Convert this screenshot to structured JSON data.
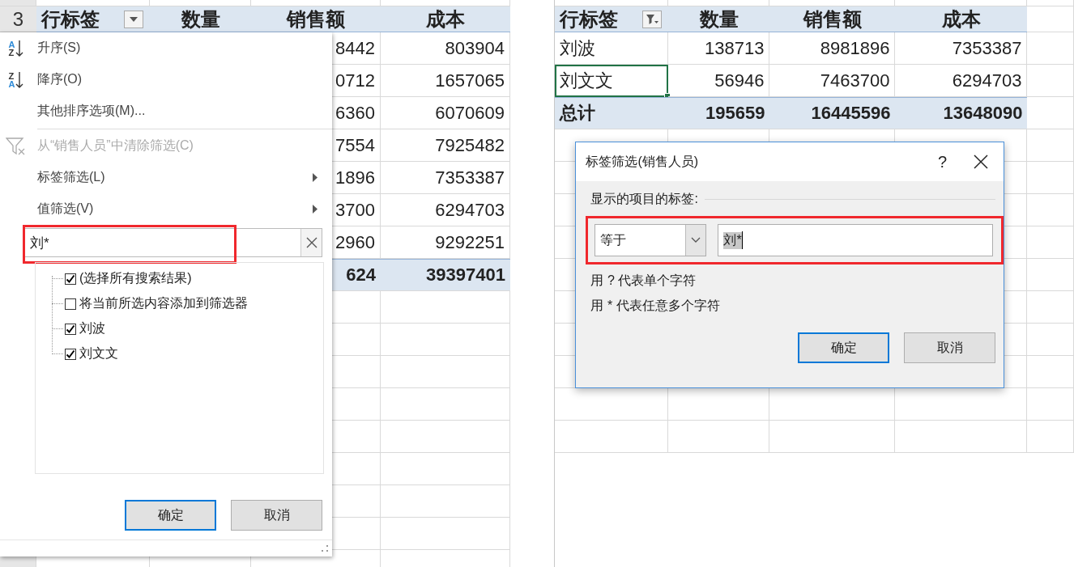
{
  "left": {
    "row_number": "3",
    "columns": [
      "行标签",
      "数量",
      "销售额",
      "成本"
    ],
    "header_filtered": false,
    "rows": [
      [
        "8442",
        "803904"
      ],
      [
        "0712",
        "1657065"
      ],
      [
        "6360",
        "6070609"
      ],
      [
        "7554",
        "7925482"
      ],
      [
        "1896",
        "7353387"
      ],
      [
        "3700",
        "6294703"
      ],
      [
        "2960",
        "9292251"
      ]
    ],
    "total": [
      "624",
      "39397401"
    ],
    "menu": {
      "items": [
        {
          "kind": "sort_asc",
          "label": "升序(S)",
          "icon_letters": [
            "A",
            "Z"
          ],
          "disabled": false
        },
        {
          "kind": "sort_desc",
          "label": "降序(O)",
          "icon_letters": [
            "Z",
            "A"
          ],
          "disabled": false
        },
        {
          "kind": "plain",
          "label": "其他排序选项(M)...",
          "disabled": false
        },
        {
          "kind": "separator"
        },
        {
          "kind": "clear_filter",
          "label": "从“销售人员”中清除筛选(C)",
          "disabled": true
        },
        {
          "kind": "submenu",
          "label": "标签筛选(L)",
          "disabled": false
        },
        {
          "kind": "submenu",
          "label": "值筛选(V)",
          "disabled": false
        }
      ],
      "search": {
        "value": "刘*",
        "highlighted": true
      },
      "tree": [
        {
          "label": "(选择所有搜索结果)",
          "checked": true
        },
        {
          "label": "将当前所选内容添加到筛选器",
          "checked": false
        },
        {
          "label": "刘波",
          "checked": true
        },
        {
          "label": "刘文文",
          "checked": true
        }
      ],
      "buttons": [
        {
          "label": "确定",
          "default": true
        },
        {
          "label": "取消",
          "default": false
        }
      ]
    }
  },
  "right": {
    "columns": [
      "行标签",
      "数量",
      "销售额",
      "成本"
    ],
    "header_filtered": true,
    "rows": [
      {
        "label": "刘波",
        "values": [
          "138713",
          "8981896",
          "7353387"
        ],
        "selected": false
      },
      {
        "label": "刘文文",
        "values": [
          "56946",
          "7463700",
          "6294703"
        ],
        "selected": true
      }
    ],
    "total": {
      "label": "总计",
      "values": [
        "195659",
        "16445596",
        "13648090"
      ]
    },
    "dialog": {
      "title": "标签筛选(销售人员)",
      "help": "?",
      "group_label": "显示的项目的标签:",
      "operator": "等于",
      "value": "刘*",
      "value_selected": true,
      "highlighted": true,
      "hints": [
        "用 ? 代表单个字符",
        "用 * 代表任意多个字符"
      ],
      "buttons": [
        {
          "label": "确定",
          "default": true
        },
        {
          "label": "取消",
          "default": false
        }
      ]
    }
  }
}
